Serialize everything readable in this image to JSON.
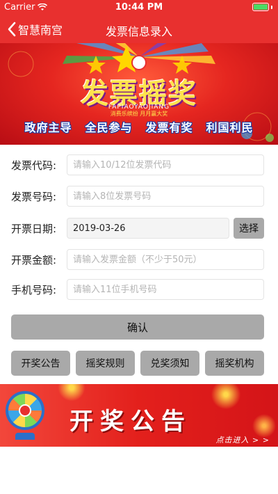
{
  "status_bar": {
    "carrier": "Carrier",
    "time": "10:44 PM",
    "battery_level": 1.0
  },
  "nav": {
    "back_label": "智慧南宫",
    "title": "发票信息录入"
  },
  "banner": {
    "title": "发票摇奖",
    "pinyin": "FAPIAOYAOJIANG",
    "tagline": "消费乐缤纷 月月赢大奖",
    "slogans": [
      "政府主导",
      "全民参与",
      "发票有奖",
      "利国利民"
    ]
  },
  "form": {
    "invoice_code": {
      "label": "发票代码:",
      "value": "",
      "placeholder": "请输入10/12位发票代码"
    },
    "invoice_number": {
      "label": "发票号码:",
      "value": "",
      "placeholder": "请输入8位发票号码"
    },
    "issue_date": {
      "label": "开票日期:",
      "value": "2019-03-26",
      "select_label": "选择"
    },
    "amount": {
      "label": "开票金额:",
      "value": "",
      "placeholder": "请输入发票金额（不少于50元）"
    },
    "phone": {
      "label": "手机号码:",
      "value": "",
      "placeholder": "请输入11位手机号码"
    },
    "confirm_label": "确认"
  },
  "actions": [
    "开奖公告",
    "摇奖规则",
    "兑奖须知",
    "摇奖机构"
  ],
  "bottom_banner": {
    "title": "开奖公告",
    "link": "点击进入 > >"
  },
  "colors": {
    "brand_red": "#e8302f",
    "button_gray": "#a9a9a9",
    "banner_yellow": "#ffe34d"
  },
  "icons": {
    "back": "chevron-left-icon",
    "wifi": "wifi-icon",
    "battery": "battery-icon",
    "wheel": "lottery-wheel-icon"
  }
}
